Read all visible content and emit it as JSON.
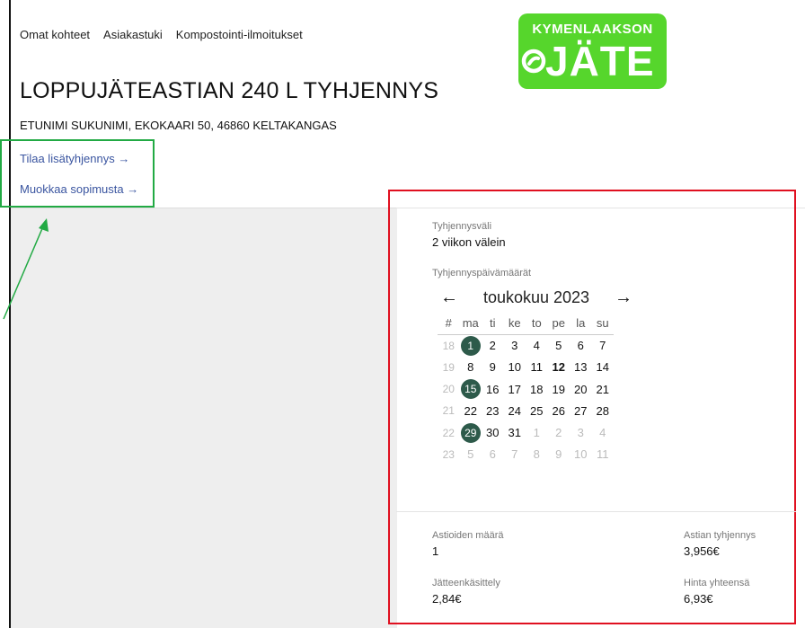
{
  "nav": {
    "items": [
      "Omat kohteet",
      "Asiakastuki",
      "Kompostointi-ilmoitukset"
    ]
  },
  "logo": {
    "top": "KYMENLAAKSON",
    "main": "JÄTE"
  },
  "page": {
    "title": "LOPPUJÄTEASTIAN 240 L TYHJENNYS",
    "address": "ETUNIMI SUKUNIMI, EKOKAARI 50, 46860 KELTAKANGAS"
  },
  "actions": {
    "order_extra": "Tilaa lisätyhjennys →",
    "edit_contract": "Muokkaa sopimusta →"
  },
  "schedule": {
    "interval_label": "Tyhjennysväli",
    "interval_value": "2 viikon välein",
    "dates_label": "Tyhjennyspäivämäärät"
  },
  "calendar": {
    "prev": "←",
    "next": "→",
    "month": "toukokuu 2023",
    "headers": [
      "#",
      "ma",
      "ti",
      "ke",
      "to",
      "pe",
      "la",
      "su"
    ],
    "weeks": [
      {
        "wk": "18",
        "days": [
          "1",
          "2",
          "3",
          "4",
          "5",
          "6",
          "7"
        ]
      },
      {
        "wk": "19",
        "days": [
          "8",
          "9",
          "10",
          "11",
          "12",
          "13",
          "14"
        ]
      },
      {
        "wk": "20",
        "days": [
          "15",
          "16",
          "17",
          "18",
          "19",
          "20",
          "21"
        ]
      },
      {
        "wk": "21",
        "days": [
          "22",
          "23",
          "24",
          "25",
          "26",
          "27",
          "28"
        ]
      },
      {
        "wk": "22",
        "days": [
          "29",
          "30",
          "31",
          "1",
          "2",
          "3",
          "4"
        ]
      },
      {
        "wk": "23",
        "days": [
          "5",
          "6",
          "7",
          "8",
          "9",
          "10",
          "11"
        ]
      }
    ],
    "highlighted": [
      "1",
      "15",
      "29"
    ],
    "today": "12",
    "highlight_color": "#2d5a4a"
  },
  "summary": {
    "container_count_label": "Astioiden määrä",
    "container_count": "1",
    "emptying_label": "Astian tyhjennys",
    "emptying_price": "3,956€",
    "waste_label": "Jätteenkäsittely",
    "waste_price": "2,84€",
    "total_label": "Hinta yhteensä",
    "total_price": "6,93€"
  },
  "colors": {
    "brand": "#56d62c",
    "link": "#3a55a0",
    "annotation_red": "#e01020",
    "annotation_green": "#22aa44"
  }
}
